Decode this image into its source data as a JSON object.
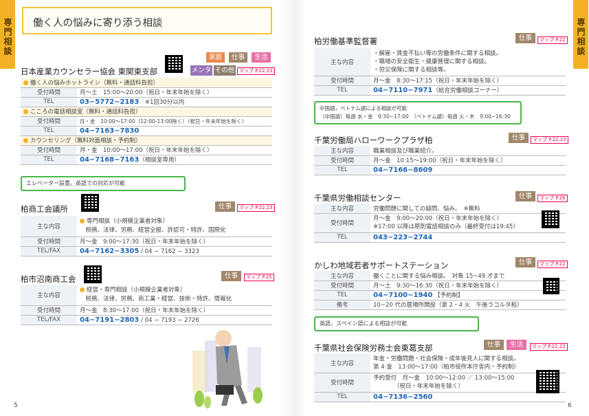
{
  "tabs": {
    "left": "専門相談",
    "right": "専門相談"
  },
  "title": "働く人の悩みに寄り添う相談",
  "page_left": "5",
  "page_right": "6",
  "labels": {
    "main": "主な内容",
    "hours": "受付時間",
    "tel": "TEL",
    "telfax": "TEL/FAX",
    "note": "備考"
  },
  "jcaa": {
    "name": "日本産業カウンセラー協会 東関東支部",
    "tags": [
      "家庭",
      "仕事",
      "生活",
      "メンタル",
      "その他"
    ],
    "map": "マップ P.22,23",
    "s1": "働く人の悩みホットライン（無料・通話料負担）",
    "s1_hours": "月～土　15:00～20:00（祝日・年末年始を除く）",
    "s1_tel": "03−5772−2183",
    "s1_tel_note": "※1回30分以内",
    "s2": "こころの電話相談室（無料・通話料負担）",
    "s2_hours": "月・金　10:00～17:00（12:00-13:00除く）（祝日・年末年始を除く）",
    "s2_tel": "04−7163−7830",
    "s3": "カウンセリング（無料対面相談・予約制）",
    "s3_hours": "月・金　10:00～17:00（祝日・年末年始を除く）",
    "s3_tel": "04−7168−7163",
    "s3_tel_note": "（相談室専用）",
    "note": "エレベーター設置。英語での対応が可能"
  },
  "cci": {
    "name": "柏商工会議所",
    "tag": "仕事",
    "map": "マップ P.22,23",
    "main1": "専門相談（小規模企業者対象）",
    "main2": "税務、法律、労務、経営全般、許認可・特許、国際化",
    "hours": "月～金　9:00～17:30（祝日・年末年始を除く）",
    "tel": "04−7162−3305",
    "fax": "/ 04 − 7162 − 3323"
  },
  "numa": {
    "name": "柏市沼南商工会",
    "tag": "仕事",
    "map": "マップ P.25",
    "main1": "経営・専門相談（小規模企業者対象）",
    "main2": "税務、法律、労務、商工業・経営、技術・特許、情報化",
    "hours": "月～金　8:30～17:00（祝日・年末年始を除く）",
    "tel": "04−7191−2803",
    "fax": "/ 04 − 7193 − 2726"
  },
  "lso": {
    "name": "柏労働基準監督署",
    "tag": "仕事",
    "map": "マップ P.22",
    "m1": "・解雇・賃金不払い等の労働条件に関する相談。",
    "m2": "・職場の安全衛生・健康管理に関する相談。",
    "m3": "・労災保険に関する相談等。",
    "hours": "月～金　8:30～17:15（祝日・年末年始を除く）",
    "tel": "04−7110−7971",
    "tel_note": "（総合労働相談コーナー）",
    "note1": "中国語，ベトナム語による相談が可能",
    "note2": "（中国語）毎週 水・金　9:30~17:00　（ベトナム語）毎週 火・木　9:00~16:30"
  },
  "hw": {
    "name": "千葉労働局ハローワークプラザ柏",
    "tag": "仕事",
    "map": "マップ P.22,23",
    "main": "職業相談及び職業紹介。",
    "hours": "月～金　10:15～19:00（祝日・年末年始を除く）",
    "tel": "04−7166−8609"
  },
  "lab": {
    "name": "千葉県労働相談センター",
    "tag": "仕事",
    "map": "マップ P.26",
    "main": "労働問題に関しての疑問、悩み。　※無料",
    "hours1": "月～金　9:00～20:00（祝日・年末年始を除く）",
    "hours2": "※17:00 以降は原則電話相談のみ（最終受付は19:45）",
    "tel": "043−223−2744"
  },
  "ys": {
    "name": "かしわ地域若者サポートステーション",
    "tag": "仕事",
    "map": "マップ P.22",
    "main": "働くことに関する悩み相談。　対象 15~49 才まで",
    "hours": "月～土　9:30～16:30（祝日・年末年始を除く）",
    "tel": "04−7100−1940",
    "tel_note": "【予約制】",
    "note": "10~20 代の居場所開設（第 2・4 火　午後ラコルタ柏）",
    "note_label": "英語，スペイン語による相談が可能"
  },
  "sr": {
    "name": "千葉県社会保険労務士会東葛支部",
    "tags": [
      "仕事",
      "生活"
    ],
    "map": "マップ P.22,23",
    "main1": "年金・労働問題・社会保険・成年後見人に関する相談。",
    "main2": "第 4 金　13:00～17:00（柏市役所本庁舎内・予約制）",
    "hours1": "予約受付　月～金　10:00～12:00 ／ 13:00～15:00",
    "hours2": "（祝日・年末年始を除く）",
    "tel": "04−7136−2560"
  }
}
